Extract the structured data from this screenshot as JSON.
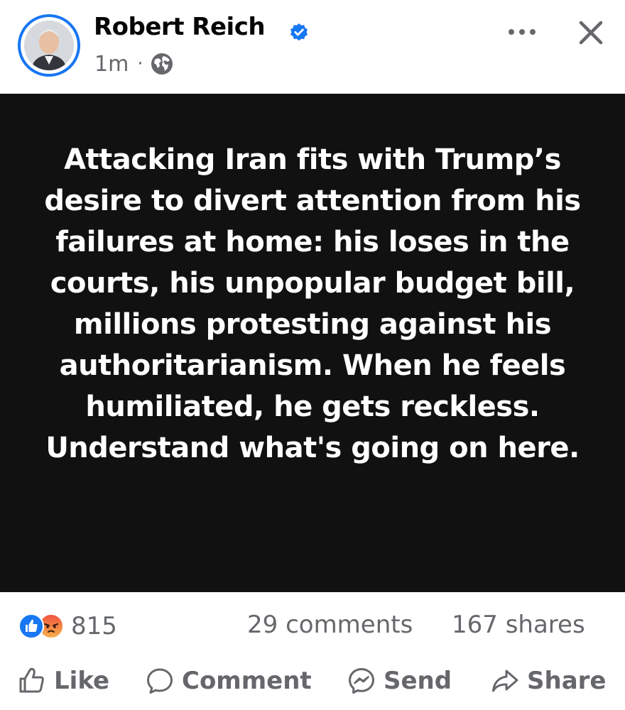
{
  "post": {
    "author": "Robert Reich",
    "timestamp": "1m",
    "separator": "·",
    "text": "Attacking Iran fits with Trump’s desire to divert attention from his failures at home: his loses in the courts, his unpopular budget bill, millions protesting against his authoritarianism. When he feels humiliated, he gets reckless. Understand what's going on here.",
    "card_background": "#111111"
  },
  "stats": {
    "reactions_count": "815",
    "reaction_types": [
      "like",
      "angry"
    ],
    "comments": "29 comments",
    "shares": "167 shares"
  },
  "actions": {
    "like_label": "Like",
    "comment_label": "Comment",
    "send_label": "Send",
    "share_label": "Share"
  },
  "icons": {
    "verified": "verified-badge-icon",
    "audience": "globe-icon",
    "more": "more-options-icon",
    "close": "close-icon",
    "like": "thumbs-up-icon",
    "comment": "comment-bubble-icon",
    "send": "messenger-icon",
    "share": "share-arrow-icon"
  },
  "colors": {
    "brand_blue": "#1877f2",
    "secondary_text": "#65676b",
    "primary_text": "#050505"
  }
}
